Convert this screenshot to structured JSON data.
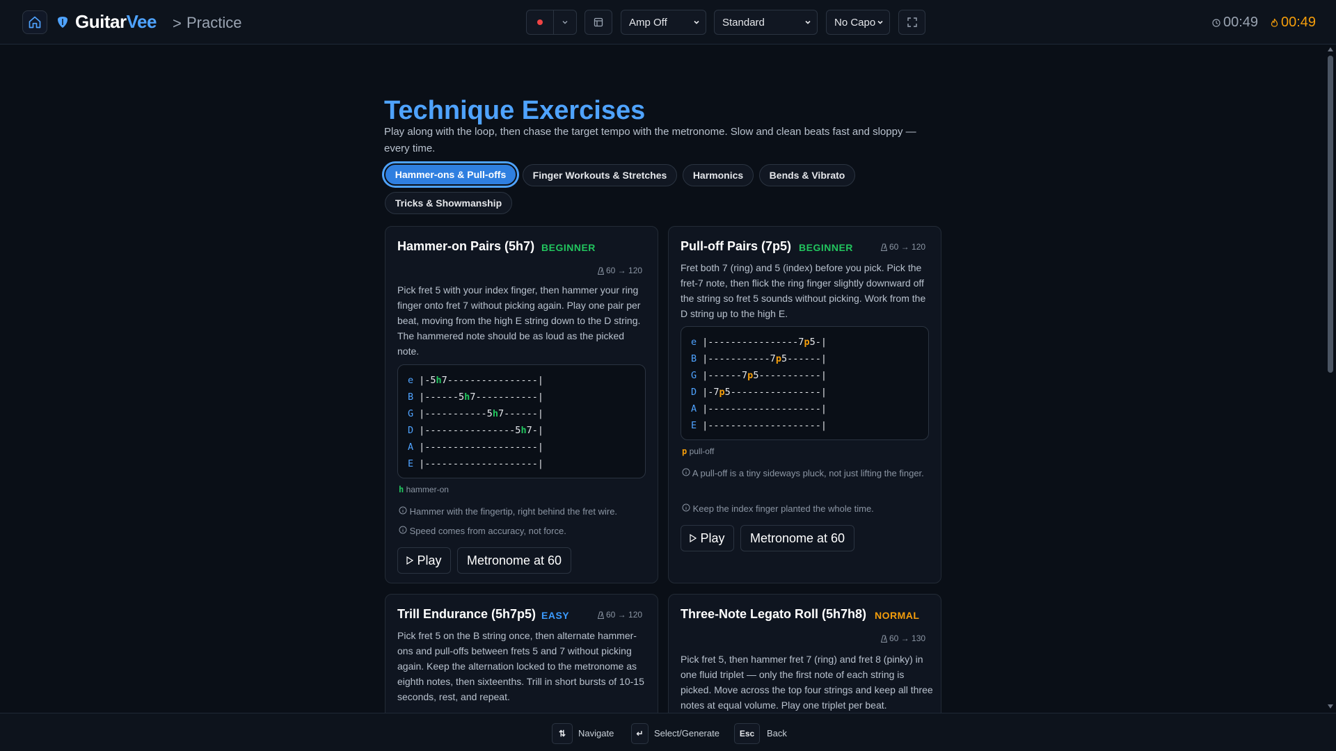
{
  "app": {
    "brand_main": "Guitar",
    "brand_accent": "Vee",
    "crumb_sep": ">",
    "crumb": "Practice"
  },
  "toolbar": {
    "amp": "Amp Off",
    "tuning": "Standard",
    "capo": "No Capo"
  },
  "timers": {
    "session": "00:49",
    "streak": "00:49"
  },
  "page": {
    "title": "Technique Exercises",
    "subtitle": "Play along with the loop, then chase the target tempo with the metronome. Slow and clean beats fast and sloppy — every time."
  },
  "tabs": [
    {
      "label": "Hammer-ons & Pull-offs",
      "active": true
    },
    {
      "label": "Finger Workouts & Stretches"
    },
    {
      "label": "Harmonics"
    },
    {
      "label": "Bends & Vibrato"
    },
    {
      "label": "Tricks & Showmanship"
    }
  ],
  "cards": [
    {
      "title": "Hammer-on Pairs (5h7)",
      "level": "BEGINNER",
      "tempo": "60 → 120",
      "description": "Pick fret 5 with your index finger, then hammer your ring finger onto fret 7 without picking again. Play one pair per beat, moving from the high E string down to the D string. The hammered note should be as loud as the picked note.",
      "tab": [
        [
          "e",
          "|-5",
          "h",
          "7----------------|"
        ],
        [
          "B",
          "|------5",
          "h",
          "7-----------|"
        ],
        [
          "G",
          "|-----------5",
          "h",
          "7------|"
        ],
        [
          "D",
          "|----------------5",
          "h",
          "7-|"
        ],
        [
          "A",
          "|--------------------|"
        ],
        [
          "E",
          "|--------------------|"
        ]
      ],
      "legend_symbol": "h",
      "legend_text": "hammer-on",
      "tips": [
        "Hammer with the fingertip, right behind the fret wire.",
        "Speed comes from accuracy, not force."
      ],
      "play": "Play",
      "metronome": "Metronome at 60"
    },
    {
      "title": "Pull-off Pairs (7p5)",
      "level": "BEGINNER",
      "tempo": "60 → 120",
      "description": "Fret both 7 (ring) and 5 (index) before you pick. Pick the fret-7 note, then flick the ring finger slightly downward off the string so fret 5 sounds without picking. Work from the D string up to the high E.",
      "tab": [
        [
          "e",
          "|----------------7",
          "p",
          "5-|"
        ],
        [
          "B",
          "|-----------7",
          "p",
          "5------|"
        ],
        [
          "G",
          "|------7",
          "p",
          "5-----------|"
        ],
        [
          "D",
          "|-7",
          "p",
          "5----------------|"
        ],
        [
          "A",
          "|--------------------|"
        ],
        [
          "E",
          "|--------------------|"
        ]
      ],
      "legend_symbol": "p",
      "legend_text": "pull-off",
      "tips": [
        "A pull-off is a tiny sideways pluck, not just lifting the finger.",
        "Keep the index finger planted the whole time."
      ],
      "play": "Play",
      "metronome": "Metronome at 60"
    },
    {
      "title": "Trill Endurance (5h7p5)",
      "level": "EASY",
      "tempo": "60 → 120",
      "description": "Pick fret 5 on the B string once, then alternate hammer-ons and pull-offs between frets 5 and 7 without picking again. Keep the alternation locked to the metronome as eighth notes, then sixteenths. Trill in short bursts of 10-15 seconds, rest, and repeat."
    },
    {
      "title": "Three-Note Legato Roll (5h7h8)",
      "level": "NORMAL",
      "tempo": "60 → 130",
      "description": "Pick fret 5, then hammer fret 7 (ring) and fret 8 (pinky) in one fluid triplet — only the first note of each string is picked. Move across the top four strings and keep all three notes at equal volume. Play one triplet per beat."
    }
  ],
  "footer": [
    {
      "key": "⇅",
      "label": "Navigate"
    },
    {
      "key": "↵",
      "label": "Select/Generate"
    },
    {
      "key": "Esc",
      "label": "Back"
    }
  ]
}
